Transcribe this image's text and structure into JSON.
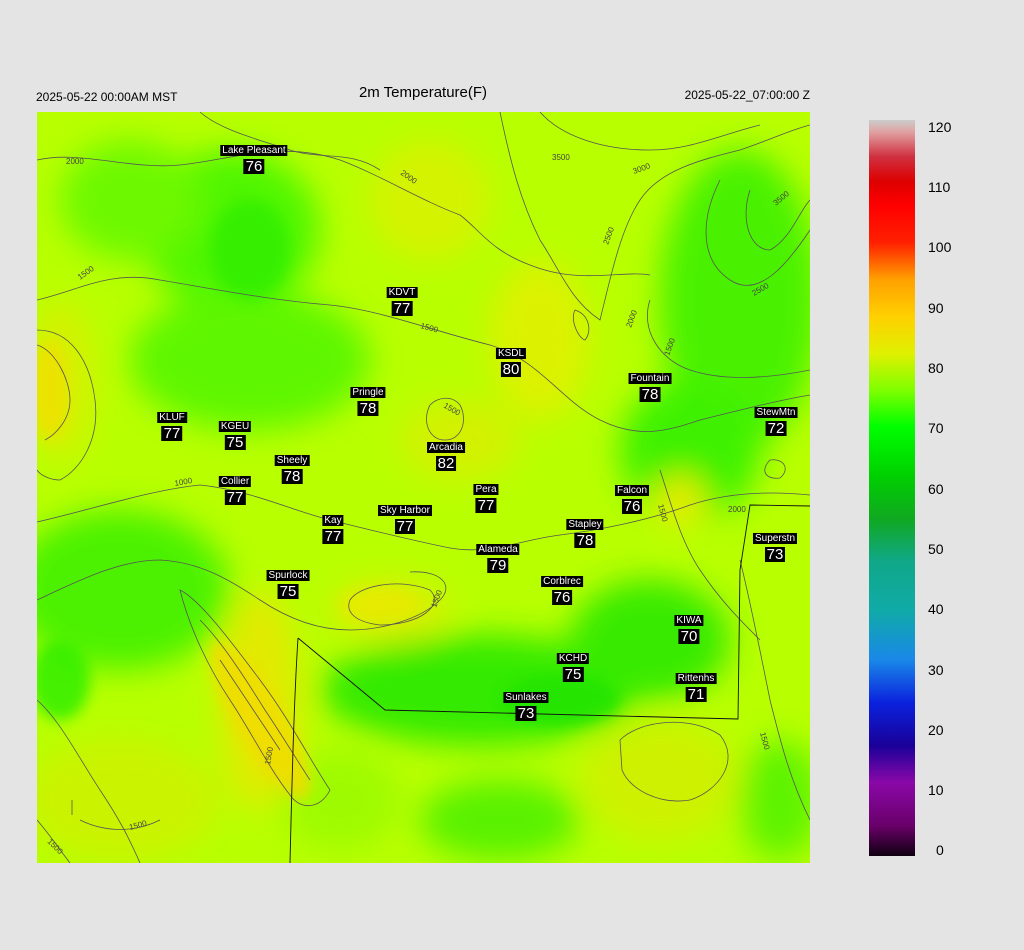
{
  "header": {
    "left": "2025-05-22 00:00AM MST",
    "title": "2m Temperature(F)",
    "right": "2025-05-22_07:00:00 Z"
  },
  "colorbar": {
    "labels": [
      "120",
      "110",
      "100",
      "90",
      "80",
      "70",
      "60",
      "50",
      "40",
      "30",
      "20",
      "10",
      "0"
    ],
    "min": 0,
    "max": 120,
    "stops": [
      {
        "v": 0,
        "c": "#100010"
      },
      {
        "v": 5,
        "c": "#6a006a"
      },
      {
        "v": 12,
        "c": "#8a08a8"
      },
      {
        "v": 18,
        "c": "#1a0099"
      },
      {
        "v": 25,
        "c": "#0a22dd"
      },
      {
        "v": 32,
        "c": "#1a88e8"
      },
      {
        "v": 40,
        "c": "#10aaa8"
      },
      {
        "v": 48,
        "c": "#10a888"
      },
      {
        "v": 55,
        "c": "#10a820"
      },
      {
        "v": 62,
        "c": "#00d000"
      },
      {
        "v": 70,
        "c": "#00ff00"
      },
      {
        "v": 76,
        "c": "#80ff00"
      },
      {
        "v": 82,
        "c": "#e0f000"
      },
      {
        "v": 88,
        "c": "#ffd000"
      },
      {
        "v": 94,
        "c": "#ffa000"
      },
      {
        "v": 100,
        "c": "#ff2000"
      },
      {
        "v": 106,
        "c": "#ff0000"
      },
      {
        "v": 110,
        "c": "#dd0000"
      },
      {
        "v": 114,
        "c": "#d03040"
      },
      {
        "v": 118,
        "c": "#e0a0a0"
      },
      {
        "v": 120,
        "c": "#cccccc"
      }
    ]
  },
  "contour_labels": [
    "2000",
    "2000",
    "3500",
    "3000",
    "3500",
    "2500",
    "2500",
    "2000",
    "1500",
    "1500",
    "1500",
    "1500",
    "1000",
    "1500",
    "2000",
    "1500",
    "1500",
    "1500",
    "1500",
    "1500"
  ],
  "stations": [
    {
      "name": "Lake Pleasant",
      "temp": "76"
    },
    {
      "name": "KDVT",
      "temp": "77"
    },
    {
      "name": "KSDL",
      "temp": "80"
    },
    {
      "name": "Fountain",
      "temp": "78"
    },
    {
      "name": "StewMtn",
      "temp": "72"
    },
    {
      "name": "Pringle",
      "temp": "78"
    },
    {
      "name": "KLUF",
      "temp": "77"
    },
    {
      "name": "KGEU",
      "temp": "75"
    },
    {
      "name": "Arcadia",
      "temp": "82"
    },
    {
      "name": "Sheely",
      "temp": "78"
    },
    {
      "name": "Collier",
      "temp": "77"
    },
    {
      "name": "Pera",
      "temp": "77"
    },
    {
      "name": "Falcon",
      "temp": "76"
    },
    {
      "name": "Kay",
      "temp": "77"
    },
    {
      "name": "Sky Harbor",
      "temp": "77"
    },
    {
      "name": "Stapley",
      "temp": "78"
    },
    {
      "name": "Superstn",
      "temp": "73"
    },
    {
      "name": "Alameda",
      "temp": "79"
    },
    {
      "name": "Spurlock",
      "temp": "75"
    },
    {
      "name": "Corblrec",
      "temp": "76"
    },
    {
      "name": "KIWA",
      "temp": "70"
    },
    {
      "name": "KCHD",
      "temp": "75"
    },
    {
      "name": "Rittenhs",
      "temp": "71"
    },
    {
      "name": "Sunlakes",
      "temp": "73"
    }
  ]
}
